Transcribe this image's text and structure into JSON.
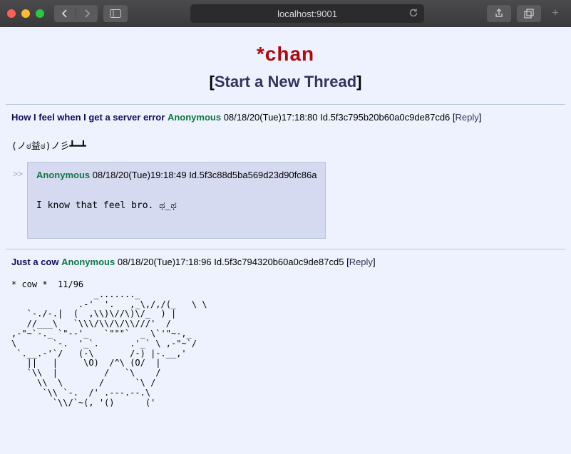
{
  "chrome": {
    "url": "localhost:9001"
  },
  "page": {
    "title": "*chan",
    "new_thread_label": "Start a New Thread",
    "reply_label": "Reply"
  },
  "threads": [
    {
      "subject": "How I feel when I get a server error",
      "author": "Anonymous",
      "timestamp": "08/18/20(Tue)17:18:80",
      "id": "Id.5f3c795b20b60a0c9de87cd6",
      "body": "(ノಠ益ಠ)ノ彡┻━┻",
      "replies": [
        {
          "author": "Anonymous",
          "timestamp": "08/18/20(Tue)19:18:49",
          "id": "Id.5f3c88d5ba569d23d90fc86a",
          "body": "I know that feel bro. ಥ_ಥ"
        }
      ]
    },
    {
      "subject": "Just a cow",
      "author": "Anonymous",
      "timestamp": "08/18/20(Tue)17:18:96",
      "id": "Id.5f3c794320b60a0c9de87cd5",
      "body": "* cow *  11/96\n                _......._\n             .-'  '.   ,_\\,/,/(_   \\ \\\n   `-./-.|  (  ,\\\\)\\//\\)\\/_  ) |\n   //___\\   `\\\\\\/\\\\/\\/\\\\///'  /\n,-\"~`-._ `\"--'_   `\"\"\"`  _ \\`'\"~-,_\n\\       `-.  '_`.      .'_` \\ ,-\"~`/\n `.__.-'`/   (-\\       /-) |-.__,'\n   ||   |     \\O)  /^\\ (O/  |\n   `\\\\  |         /   `\\    /\n     \\\\  \\       /      `\\ /\n      `\\\\ `-.  /' .---.--.\\\n        `\\\\/`~(, '()      ('",
      "replies": []
    }
  ]
}
